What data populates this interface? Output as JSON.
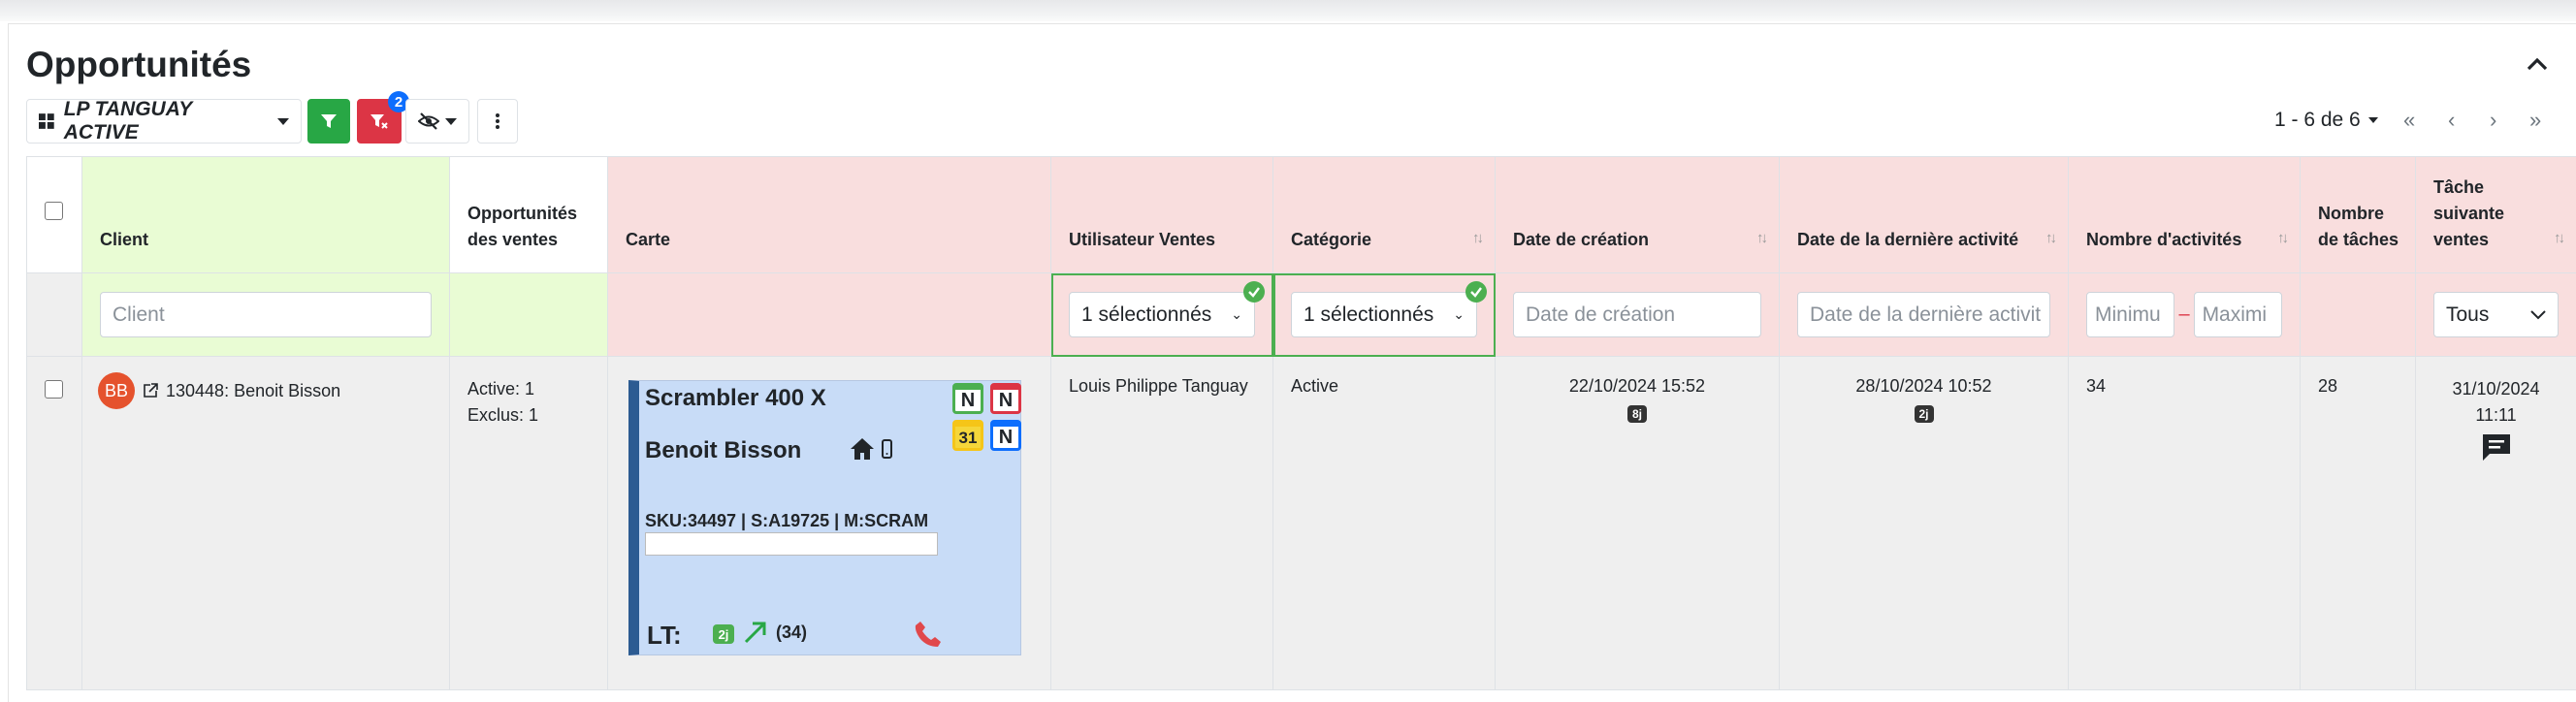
{
  "page": {
    "title": "Opportunités"
  },
  "toolbar": {
    "view_label": "LP TANGUAY ACTIVE",
    "filter_badge": "2"
  },
  "pagination": {
    "range": "1 - 6 de 6",
    "first": "«",
    "prev": "‹",
    "next": "›",
    "last": "»"
  },
  "columns": {
    "client": "Client",
    "opportunities": "Opportunités des ventes",
    "card": "Carte",
    "sales_user": "Utilisateur Ventes",
    "category": "Catégorie",
    "created": "Date de création",
    "last_activity": "Date de la dernière activité",
    "activity_count": "Nombre d'activités",
    "task_count": "Nombre de tâches",
    "next_task": "Tâche suivante ventes"
  },
  "filters": {
    "client_placeholder": "Client",
    "sales_user_value": "1 sélectionnés",
    "category_value": "1 sélectionnés",
    "created_placeholder": "Date de création",
    "last_activity_placeholder": "Date de la dernière activit",
    "min_placeholder": "Minimu",
    "range_sep": "–",
    "max_placeholder": "Maximi",
    "next_task_value": "Tous"
  },
  "row": {
    "avatar": "BB",
    "client": "130448: Benoit Bisson",
    "opp_active": "Active: 1",
    "opp_excluded": "Exclus: 1",
    "card": {
      "title": "Scrambler 400 X",
      "name": "Benoit Bisson",
      "sku": "SKU:34497 | S:A19725 | M:SCRAM",
      "cal1": "N",
      "cal2": "N",
      "cal3": "31",
      "cal4": "N",
      "lt_label": "LT:",
      "lt_tag": "2j",
      "lt_count": "(34)"
    },
    "sales_user": "Louis Philippe Tanguay",
    "category": "Active",
    "created_date": "22/10/2024 15:52",
    "created_tag": "8j",
    "last_activity_date": "28/10/2024 10:52",
    "last_activity_tag": "2j",
    "activity_count": "34",
    "task_count": "28",
    "next_task_date": "31/10/2024",
    "next_task_time": "11:11"
  },
  "colors": {
    "green": "#28a745",
    "red": "#dc3545",
    "blue": "#0d6efd",
    "avatar": "#e5522d",
    "card_bg": "#c8dcf7",
    "card_bar": "#2c5b92"
  },
  "icons": [
    "grid-icon",
    "filter-icon",
    "filter-remove-icon",
    "eye-off-icon",
    "kebab-icon",
    "chevron-up-icon",
    "external-link-icon",
    "home-icon",
    "phone-icon",
    "calendar-icon",
    "trend-up-icon",
    "comment-icon",
    "check-icon"
  ]
}
